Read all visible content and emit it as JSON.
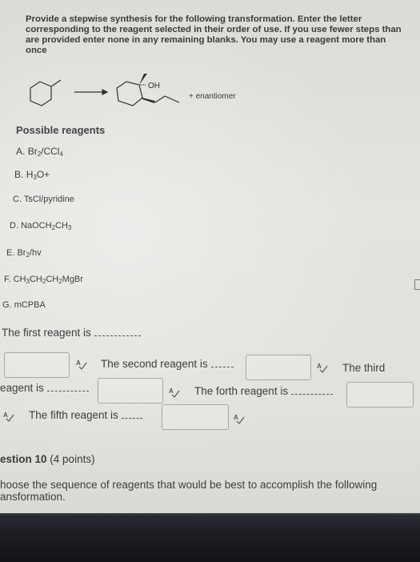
{
  "question": {
    "instructions": "Provide a stepwise synthesis for the following transformation. Enter the letter corresponding to the reagent selected in their order of use. If you use fewer steps than are provided enter none in any remaining blanks. You may use a reagent more than once",
    "reaction": {
      "starting_material": "methylcyclohexane",
      "product": "1-methyl-2-propylcyclohexan-1-ol",
      "product_label": "OH",
      "note": "+ enantiomer"
    },
    "reagents_title": "Possible reagents",
    "reagents": [
      {
        "letter": "A.",
        "formula_html": "Br<sub>2</sub>/CCl<sub>4</sub>"
      },
      {
        "letter": "B.",
        "formula_html": "H<sub>3</sub>O+"
      },
      {
        "letter": "C.",
        "formula_html": "TsCl/pyridine"
      },
      {
        "letter": "D.",
        "formula_html": "NaOCH<sub>2</sub>CH<sub>3</sub>"
      },
      {
        "letter": "E.",
        "formula_html": "Br<sub>2</sub>/hv"
      },
      {
        "letter": "F.",
        "formula_html": "CH<sub>3</sub>CH<sub>2</sub>CH<sub>2</sub>MgBr"
      },
      {
        "letter": "G.",
        "formula_html": "mCPBA"
      }
    ],
    "prompts": {
      "first": "The first reagent is",
      "second": "The second reagent is",
      "third_a": "The third",
      "third_b": "eagent is",
      "fourth": "The forth reagent is",
      "fifth": "The fifth reagent is"
    },
    "answers": {
      "first": "",
      "second": "",
      "third": "",
      "fourth": "",
      "fifth": ""
    }
  },
  "next_question": {
    "title": "estion 10",
    "points": "(4 points)",
    "body": "hoose the sequence of reagents that would be best to accomplish the following ansformation."
  },
  "icons": {
    "spellcheck": "spellcheck-icon"
  }
}
